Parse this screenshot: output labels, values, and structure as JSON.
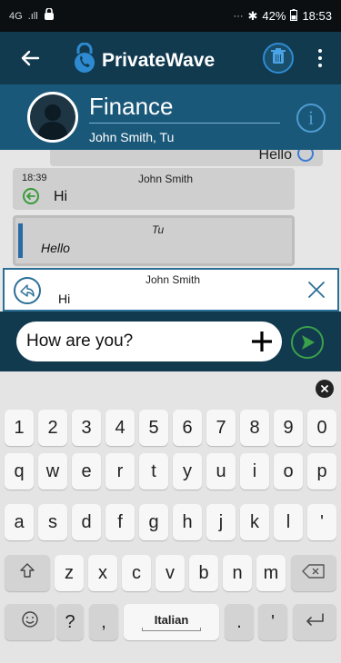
{
  "status_bar": {
    "network": "4G",
    "signal": ".ıll",
    "dots": "···",
    "bluetooth": "✱",
    "battery": "42%",
    "time": "18:53"
  },
  "app_bar": {
    "brand": "PrivateWave"
  },
  "group": {
    "title": "Finance",
    "members": "John Smith, Tu"
  },
  "messages": [
    {
      "type": "outgoing-partial",
      "text": "Hello"
    },
    {
      "type": "incoming",
      "time": "18:39",
      "sender": "John Smith",
      "text": "Hi"
    },
    {
      "type": "quote",
      "sender": "Tu",
      "text": "Hello"
    }
  ],
  "reply_preview": {
    "sender": "John Smith",
    "text": "Hi"
  },
  "composer": {
    "input_value": "How are you?"
  },
  "keyboard": {
    "row_numbers": [
      "1",
      "2",
      "3",
      "4",
      "5",
      "6",
      "7",
      "8",
      "9",
      "0"
    ],
    "row_q": [
      "q",
      "w",
      "e",
      "r",
      "t",
      "y",
      "u",
      "i",
      "o",
      "p"
    ],
    "row_a": [
      "a",
      "s",
      "d",
      "f",
      "g",
      "h",
      "j",
      "k",
      "l",
      "'"
    ],
    "row_z": [
      "z",
      "x",
      "c",
      "v",
      "b",
      "n",
      "m"
    ],
    "question": "?",
    "comma": ",",
    "space_label": "Italian",
    "period": ".",
    "apostrophe": "'"
  },
  "colors": {
    "app_bar": "#113a4f",
    "header": "#1a5879",
    "accent_blue": "#2e8bd2",
    "send_green": "#3aa14a"
  }
}
